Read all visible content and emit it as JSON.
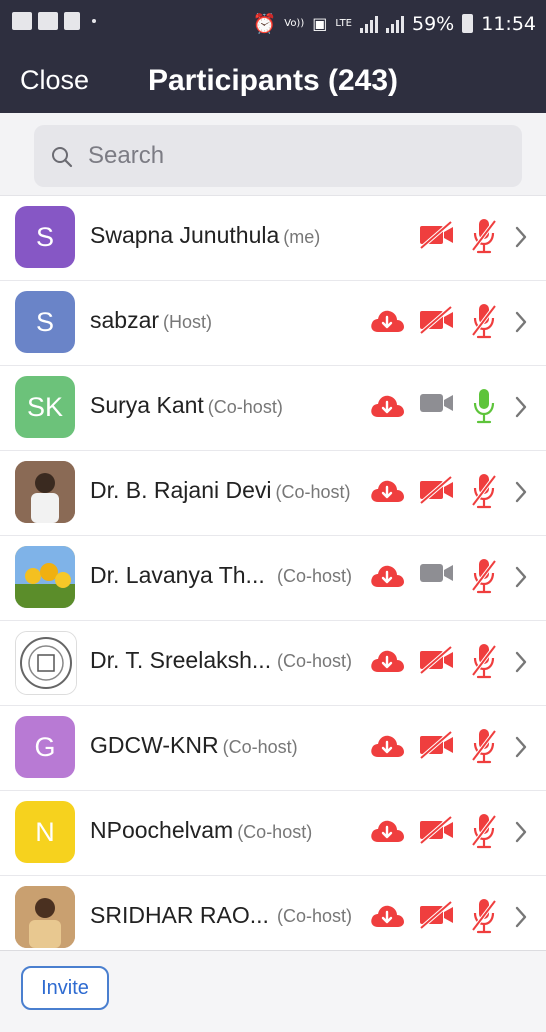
{
  "status_bar": {
    "volte": "Vo))",
    "lte_small": "LTE",
    "lte": "LTE",
    "battery": "59%",
    "time": "11:54"
  },
  "header": {
    "close_label": "Close",
    "title": "Participants (243)"
  },
  "search": {
    "placeholder": "Search"
  },
  "participants": [
    {
      "name": "Swapna Junuthula",
      "role": "(me)",
      "initials": "S",
      "avatar_color": "#8657c5",
      "cloud": false,
      "video_on": false,
      "mic_on": false
    },
    {
      "name": "sabzar",
      "role": "(Host)",
      "initials": "S",
      "avatar_color": "#6a84c8",
      "cloud": true,
      "video_on": false,
      "mic_on": false
    },
    {
      "name": "Surya Kant",
      "role": "(Co-host)",
      "initials": "SK",
      "avatar_color": "#6cc27a",
      "cloud": true,
      "video_on": true,
      "mic_on": true
    },
    {
      "name": "Dr. B. Rajani Devi",
      "role": "(Co-host)",
      "initials": "",
      "avatar_color": "#9b6b4f",
      "cloud": true,
      "video_on": false,
      "mic_on": false
    },
    {
      "name": "Dr. Lavanya Th...",
      "role": "(Co-host)",
      "initials": "",
      "avatar_color": "#e8b428",
      "cloud": true,
      "video_on": true,
      "mic_on": false
    },
    {
      "name": "Dr. T. Sreelaksh...",
      "role": "(Co-host)",
      "initials": "",
      "avatar_color": "#ffffff",
      "cloud": true,
      "video_on": false,
      "mic_on": false
    },
    {
      "name": "GDCW-KNR",
      "role": "(Co-host)",
      "initials": "G",
      "avatar_color": "#b87ad4",
      "cloud": true,
      "video_on": false,
      "mic_on": false
    },
    {
      "name": "NPoochelvam",
      "role": "(Co-host)",
      "initials": "N",
      "avatar_color": "#f6d21e",
      "cloud": true,
      "video_on": false,
      "mic_on": false
    },
    {
      "name": "SRIDHAR RAO...",
      "role": "(Co-host)",
      "initials": "",
      "avatar_color": "#b5865a",
      "cloud": true,
      "video_on": false,
      "mic_on": false
    }
  ],
  "footer": {
    "invite_label": "Invite"
  },
  "colors": {
    "muted_red": "#ef3e3e",
    "video_gray": "#8e8e93",
    "mic_green": "#5ec43b",
    "header_bg": "#2e2f3f"
  }
}
